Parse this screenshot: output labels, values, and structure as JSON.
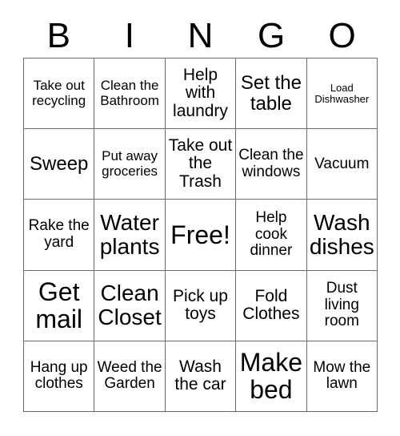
{
  "card": {
    "title": "BINGO",
    "header_letters": [
      "B",
      "I",
      "N",
      "G",
      "O"
    ],
    "grid_size": "5x5",
    "free_space_label": "Free!",
    "colors": {
      "background": "#ffffff",
      "text": "#000000",
      "grid_line": "#6b6b6b"
    },
    "rows": [
      [
        {
          "label": "Take out recycling",
          "size": "s",
          "free": false
        },
        {
          "label": "Clean the Bathroom",
          "size": "s",
          "free": false
        },
        {
          "label": "Help with laundry",
          "size": "ml",
          "free": false
        },
        {
          "label": "Set the table",
          "size": "l",
          "free": false
        },
        {
          "label": "Load Dishwasher",
          "size": "xs",
          "free": false
        }
      ],
      [
        {
          "label": "Sweep",
          "size": "l",
          "free": false
        },
        {
          "label": "Put away groceries",
          "size": "s",
          "free": false
        },
        {
          "label": "Take out the Trash",
          "size": "ml",
          "free": false
        },
        {
          "label": "Clean the windows",
          "size": "m",
          "free": false
        },
        {
          "label": "Vacuum",
          "size": "m",
          "free": false
        }
      ],
      [
        {
          "label": "Rake the yard",
          "size": "m",
          "free": false
        },
        {
          "label": "Water plants",
          "size": "xl",
          "free": false
        },
        {
          "label": "Free!",
          "size": "xxl",
          "free": true
        },
        {
          "label": "Help cook dinner",
          "size": "m",
          "free": false
        },
        {
          "label": "Wash dishes",
          "size": "xl",
          "free": false
        }
      ],
      [
        {
          "label": "Get mail",
          "size": "xxl",
          "free": false
        },
        {
          "label": "Clean Closet",
          "size": "xl",
          "free": false
        },
        {
          "label": "Pick up toys",
          "size": "ml",
          "free": false
        },
        {
          "label": "Fold Clothes",
          "size": "ml",
          "free": false
        },
        {
          "label": "Dust living room",
          "size": "m",
          "free": false
        }
      ],
      [
        {
          "label": "Hang up clothes",
          "size": "m",
          "free": false
        },
        {
          "label": "Weed the Garden",
          "size": "m",
          "free": false
        },
        {
          "label": "Wash the car",
          "size": "ml",
          "free": false
        },
        {
          "label": "Make bed",
          "size": "xxl",
          "free": false
        },
        {
          "label": "Mow the lawn",
          "size": "m",
          "free": false
        }
      ]
    ]
  }
}
